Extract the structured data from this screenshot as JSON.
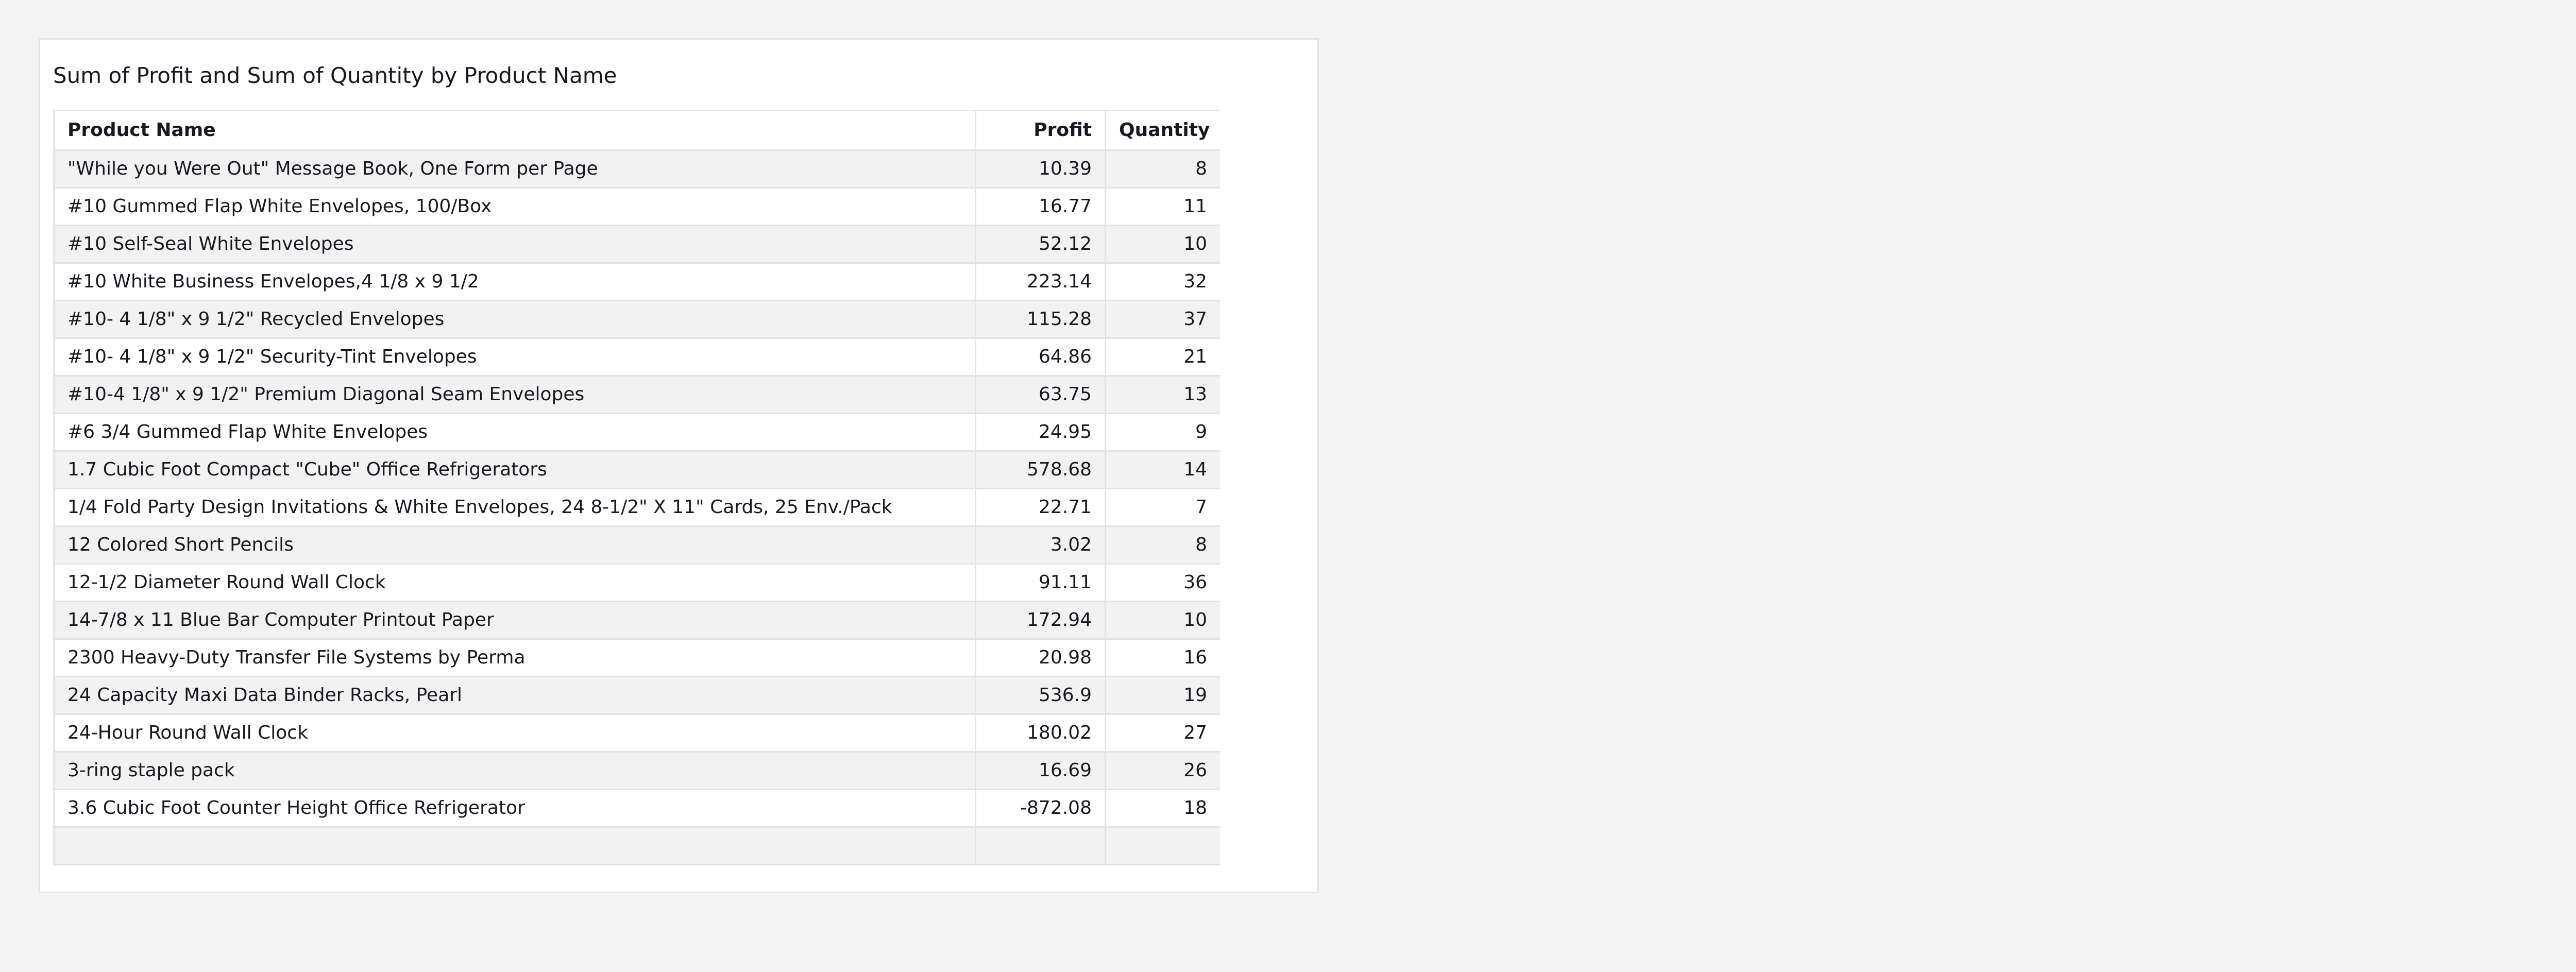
{
  "visual": {
    "title": "Sum of Profit and Sum of Quantity by Product Name"
  },
  "table": {
    "columns": [
      "Product Name",
      "Profit",
      "Quantity"
    ],
    "rows": [
      {
        "name": "\"While you Were Out\" Message Book, One Form per Page",
        "profit": "10.39",
        "quantity": "8"
      },
      {
        "name": "#10 Gummed Flap White Envelopes, 100/Box",
        "profit": "16.77",
        "quantity": "11"
      },
      {
        "name": "#10 Self-Seal White Envelopes",
        "profit": "52.12",
        "quantity": "10"
      },
      {
        "name": "#10 White Business Envelopes,4 1/8 x 9 1/2",
        "profit": "223.14",
        "quantity": "32"
      },
      {
        "name": "#10- 4 1/8\" x 9 1/2\" Recycled Envelopes",
        "profit": "115.28",
        "quantity": "37"
      },
      {
        "name": "#10- 4 1/8\" x 9 1/2\" Security-Tint Envelopes",
        "profit": "64.86",
        "quantity": "21"
      },
      {
        "name": "#10-4 1/8\" x 9 1/2\" Premium Diagonal Seam Envelopes",
        "profit": "63.75",
        "quantity": "13"
      },
      {
        "name": "#6 3/4 Gummed Flap White Envelopes",
        "profit": "24.95",
        "quantity": "9"
      },
      {
        "name": "1.7 Cubic Foot Compact \"Cube\" Office Refrigerators",
        "profit": "578.68",
        "quantity": "14"
      },
      {
        "name": "1/4 Fold Party Design Invitations & White Envelopes, 24 8-1/2\" X 11\" Cards, 25 Env./Pack",
        "profit": "22.71",
        "quantity": "7"
      },
      {
        "name": "12 Colored Short Pencils",
        "profit": "3.02",
        "quantity": "8"
      },
      {
        "name": "12-1/2 Diameter Round Wall Clock",
        "profit": "91.11",
        "quantity": "36"
      },
      {
        "name": "14-7/8 x 11 Blue Bar Computer Printout Paper",
        "profit": "172.94",
        "quantity": "10"
      },
      {
        "name": "2300 Heavy-Duty Transfer File Systems by Perma",
        "profit": "20.98",
        "quantity": "16"
      },
      {
        "name": "24 Capacity Maxi Data Binder Racks, Pearl",
        "profit": "536.9",
        "quantity": "19"
      },
      {
        "name": "24-Hour Round Wall Clock",
        "profit": "180.02",
        "quantity": "27"
      },
      {
        "name": "3-ring staple pack",
        "profit": "16.69",
        "quantity": "26"
      },
      {
        "name": "3.6 Cubic Foot Counter Height Office Refrigerator",
        "profit": "-872.08",
        "quantity": "18"
      }
    ]
  }
}
